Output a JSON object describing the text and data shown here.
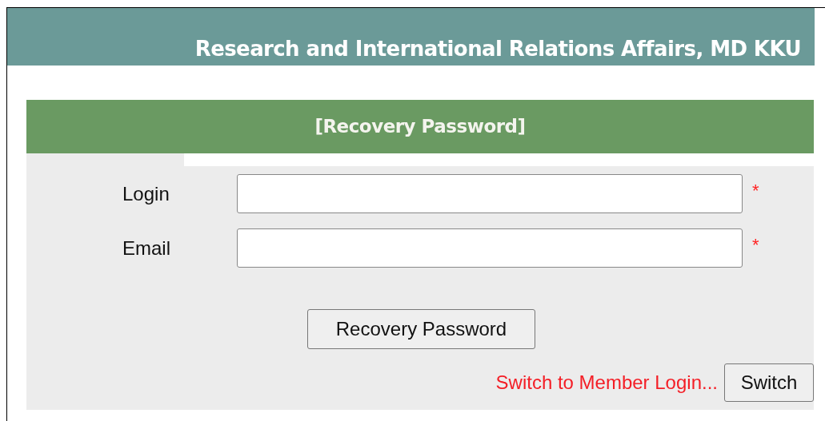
{
  "header": {
    "subtitle": "Research and International Relations Affairs, MD KKU"
  },
  "form": {
    "title": "[Recovery Password]",
    "fields": [
      {
        "label": "Login",
        "required_mark": "*"
      },
      {
        "label": "Email",
        "required_mark": "*"
      }
    ],
    "submit": "Recovery Password",
    "switch_text": "Switch to Member Login...",
    "switch_button": "Switch"
  }
}
